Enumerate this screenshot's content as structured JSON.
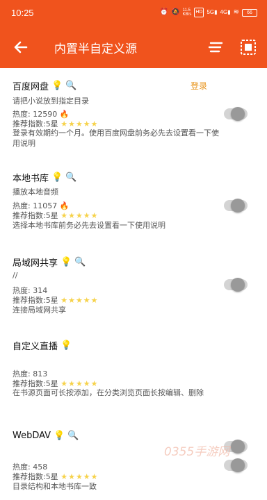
{
  "status_bar": {
    "time": "10:25",
    "icons": [
      "alarm-icon",
      "mute-icon",
      "speed-icon",
      "hd-icon",
      "5g-icon",
      "4g-icon",
      "wifi-icon"
    ],
    "speed": "11.5\nKB/s",
    "battery": "66"
  },
  "header": {
    "title": "内置半自定义源",
    "bg_color": "#f0531d"
  },
  "sources": [
    {
      "name": "百度网盘",
      "badges": "💡 🔍",
      "action": "登录",
      "description": "请把小说放到指定目录",
      "heat": "热度: 12590",
      "hot": "🔥",
      "rating": "推荐指数:5星",
      "stars": "★★★★★",
      "note": "登录有效期约一个月。使用百度网盘前务必先去设置看一下使用说明",
      "enabled": false
    },
    {
      "name": "本地书库",
      "badges": "💡 🔍",
      "description": "播放本地音频",
      "heat": "热度: 11057",
      "hot": "🔥",
      "rating": "推荐指数:5星",
      "stars": "★★★★★",
      "note": "选择本地书库前务必先去设置看一下使用说明",
      "enabled": false
    },
    {
      "name": "局域网共享",
      "badges": "💡 🔍",
      "description": "//",
      "heat": "热度: 314",
      "rating": "推荐指数:5星",
      "stars": "★★★★★",
      "note": "连接局域网共享",
      "enabled": false
    },
    {
      "name": "自定义直播",
      "badges": "💡",
      "heat": "热度: 813",
      "rating": "推荐指数:5星",
      "stars": "★★★★★",
      "note": "在书源页面可长按添加，在分类浏览页面长按编辑、删除",
      "enabled": false
    },
    {
      "name": "WebDAV",
      "badges": "💡 🔍",
      "heat": "热度: 458",
      "rating": "推荐指数:5星",
      "stars": "★★★★★",
      "note": "目录结构和本地书库一致",
      "enabled": false
    }
  ],
  "watermark": "0355手游网"
}
